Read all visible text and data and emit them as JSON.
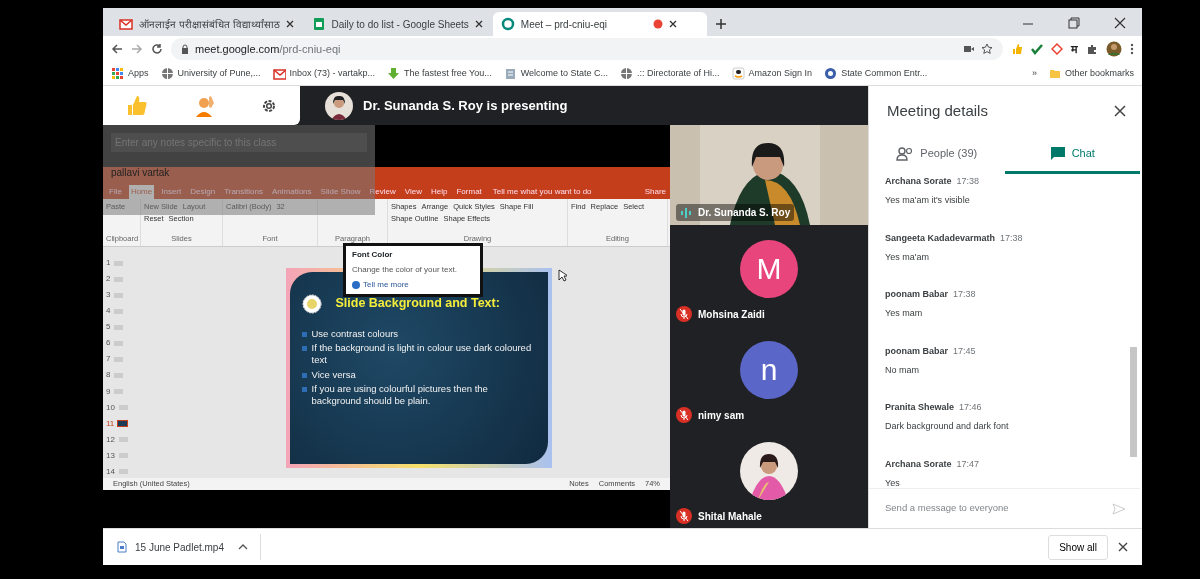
{
  "browser": {
    "tabs": [
      {
        "title": "ऑनलाईन परीक्षासंबंधित विद्यार्थ्यांसाठ",
        "selected": false
      },
      {
        "title": "Daily to do list - Google Sheets",
        "selected": false
      },
      {
        "title": "Meet – prd-cniu-eqi",
        "selected": true
      }
    ],
    "url_host": "meet.google.com",
    "url_path": "/prd-cniu-eqi",
    "extension_letter": "म",
    "bookmarks": [
      {
        "label": "Apps"
      },
      {
        "label": "University of Pune,..."
      },
      {
        "label": "Inbox (73) - vartakp..."
      },
      {
        "label": "The fastest free You..."
      },
      {
        "label": "Welcome to State C..."
      },
      {
        "label": ".:: Directorate of Hi..."
      },
      {
        "label": "Amazon Sign In"
      },
      {
        "label": "State Common Entr..."
      }
    ],
    "more_bookmarks": "»",
    "other_bookmarks": "Other bookmarks"
  },
  "meet": {
    "presenting": "Dr. Sunanda S. Roy is presenting",
    "notes_overlay": {
      "placeholder": "Enter any notes specific to this class",
      "name": "pallavi vartak"
    },
    "powerpoint": {
      "tabs": [
        {
          "label": "File",
          "selected": false
        },
        {
          "label": "Home",
          "selected": true
        },
        {
          "label": "Insert",
          "selected": false
        },
        {
          "label": "Design",
          "selected": false
        },
        {
          "label": "Transitions",
          "selected": false
        },
        {
          "label": "Animations",
          "selected": false
        },
        {
          "label": "Slide Show",
          "selected": false
        },
        {
          "label": "Review",
          "selected": false
        },
        {
          "label": "View",
          "selected": false
        },
        {
          "label": "Help",
          "selected": false
        },
        {
          "label": "Format",
          "selected": false
        }
      ],
      "tell_me": "Tell me what you want to do",
      "share": "Share",
      "ribbon_groups": [
        {
          "label": "Clipboard",
          "items": [
            "Paste"
          ]
        },
        {
          "label": "Slides",
          "items": [
            "New Slide",
            "Layout",
            "Reset",
            "Section"
          ]
        },
        {
          "label": "Font",
          "items": [
            "Calibri (Body)",
            "32"
          ]
        },
        {
          "label": "Paragraph"
        },
        {
          "label": "Drawing",
          "items": [
            "Shapes",
            "Arrange",
            "Quick Styles",
            "Shape Fill",
            "Shape Outline",
            "Shape Effects"
          ]
        },
        {
          "label": "Editing",
          "items": [
            "Find",
            "Replace",
            "Select"
          ]
        }
      ],
      "status": {
        "language": "English (United States)",
        "notes": "Notes",
        "comments": "Comments",
        "zoom": "74%"
      },
      "tooltip": {
        "title": "Font Color",
        "text": "Change the color of your text.",
        "link": "Tell me more"
      },
      "thumbnails": [
        {
          "number": "1",
          "selected": false
        },
        {
          "number": "2",
          "selected": false
        },
        {
          "number": "3",
          "selected": false
        },
        {
          "number": "4",
          "selected": false
        },
        {
          "number": "5",
          "selected": false
        },
        {
          "number": "6",
          "selected": false
        },
        {
          "number": "7",
          "selected": false
        },
        {
          "number": "8",
          "selected": false
        },
        {
          "number": "9",
          "selected": false
        },
        {
          "number": "10",
          "selected": false
        },
        {
          "number": "11",
          "selected": true
        },
        {
          "number": "12",
          "selected": false
        },
        {
          "number": "13",
          "selected": false
        },
        {
          "number": "14",
          "selected": false
        }
      ],
      "slide": {
        "title": "Slide Background and Text:",
        "bullets": [
          "Use contrast colours",
          "If the background is light in colour use dark coloured text",
          "Vice versa",
          "If you are using colourful pictures then the background should be plain."
        ]
      }
    },
    "participants": [
      {
        "name": "Dr. Sunanda S. Roy",
        "kind": "video"
      },
      {
        "name": "Mohsina Zaidi",
        "kind": "initial",
        "initial": "M",
        "color": "#e8457c",
        "muted": true
      },
      {
        "name": "nimy sam",
        "kind": "initial",
        "initial": "n",
        "color": "#5a66c8",
        "muted": true
      },
      {
        "name": "Shital Mahale",
        "muted": true
      }
    ]
  },
  "panel": {
    "title": "Meeting details",
    "tabs": [
      {
        "label": "People (39)",
        "kind": "people",
        "selected": false
      },
      {
        "label": "Chat",
        "kind": "chat",
        "selected": true
      }
    ],
    "messages": [
      {
        "sender": "Archana Sorate",
        "time": "17:38",
        "text": "Yes ma'am it's visible"
      },
      {
        "sender": "Sangeeta Kadadevarmath",
        "time": "17:38",
        "text": "Yes ma'am"
      },
      {
        "sender": "poonam Babar",
        "time": "17:38",
        "text": "Yes mam"
      },
      {
        "sender": "poonam Babar",
        "time": "17:45",
        "text": "No mam"
      },
      {
        "sender": "Pranita Shewale",
        "time": "17:46",
        "text": "Dark background and dark font"
      },
      {
        "sender": "Archana Sorate",
        "time": "17:47",
        "text": "Yes"
      }
    ],
    "input_placeholder": "Send a message to everyone"
  },
  "downloads": {
    "file": "15 June Padlet.mp4",
    "show_all": "Show all"
  }
}
